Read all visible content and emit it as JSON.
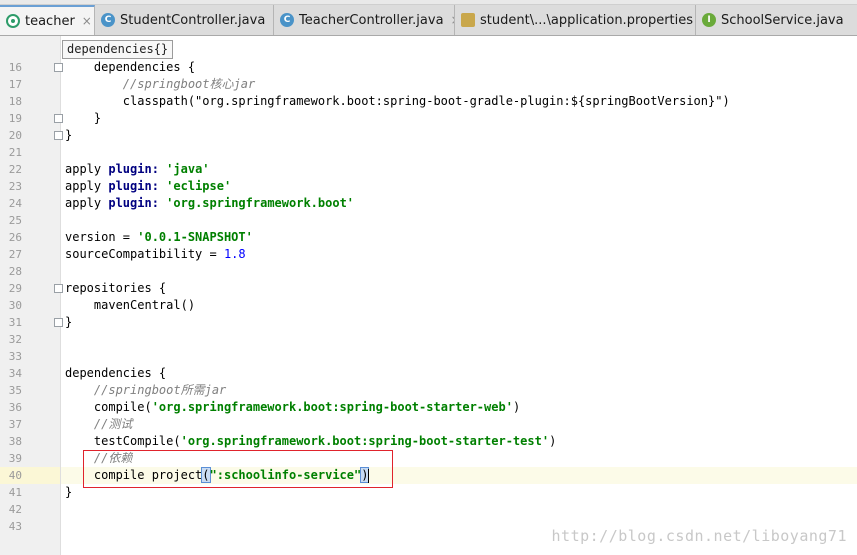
{
  "tabs": [
    {
      "label": "teacher",
      "icon": "gradle-icon",
      "active": true
    },
    {
      "label": "StudentController.java",
      "icon": "class-icon",
      "active": false
    },
    {
      "label": "TeacherController.java",
      "icon": "class-icon",
      "active": false
    },
    {
      "label": "student\\...\\application.properties",
      "icon": "properties-icon",
      "active": false
    },
    {
      "label": "SchoolService.java",
      "icon": "interface-icon",
      "active": false
    }
  ],
  "tab_close_glyph": "×",
  "tooltip": "dependencies{}",
  "icon_letters": {
    "class": "C",
    "interface": "I"
  },
  "lines": [
    {
      "num": "16",
      "segs": [
        {
          "t": "    dependencies {",
          "c": ""
        }
      ]
    },
    {
      "num": "17",
      "segs": [
        {
          "t": "        //springboot核心jar",
          "c": "cmt"
        }
      ]
    },
    {
      "num": "18",
      "segs": [
        {
          "t": "        classpath(\"org.springframework.boot:spring-boot-gradle-plugin:${springBootVersion}\")",
          "c": ""
        }
      ]
    },
    {
      "num": "19",
      "segs": [
        {
          "t": "    }",
          "c": ""
        }
      ]
    },
    {
      "num": "20",
      "segs": [
        {
          "t": "}",
          "c": ""
        }
      ]
    },
    {
      "num": "21",
      "segs": []
    },
    {
      "num": "22",
      "segs": [
        {
          "t": "apply ",
          "c": ""
        },
        {
          "t": "plugin:",
          "c": "kw"
        },
        {
          "t": " ",
          "c": ""
        },
        {
          "t": "'java'",
          "c": "str"
        }
      ]
    },
    {
      "num": "23",
      "segs": [
        {
          "t": "apply ",
          "c": ""
        },
        {
          "t": "plugin:",
          "c": "kw"
        },
        {
          "t": " ",
          "c": ""
        },
        {
          "t": "'eclipse'",
          "c": "str"
        }
      ]
    },
    {
      "num": "24",
      "segs": [
        {
          "t": "apply ",
          "c": ""
        },
        {
          "t": "plugin:",
          "c": "kw"
        },
        {
          "t": " ",
          "c": ""
        },
        {
          "t": "'org.springframework.boot'",
          "c": "str"
        }
      ]
    },
    {
      "num": "25",
      "segs": []
    },
    {
      "num": "26",
      "segs": [
        {
          "t": "version = ",
          "c": ""
        },
        {
          "t": "'0.0.1-SNAPSHOT'",
          "c": "str"
        }
      ]
    },
    {
      "num": "27",
      "segs": [
        {
          "t": "sourceCompatibility = ",
          "c": ""
        },
        {
          "t": "1.8",
          "c": "num"
        }
      ]
    },
    {
      "num": "28",
      "segs": []
    },
    {
      "num": "29",
      "segs": [
        {
          "t": "repositories {",
          "c": ""
        }
      ]
    },
    {
      "num": "30",
      "segs": [
        {
          "t": "    mavenCentral()",
          "c": ""
        }
      ]
    },
    {
      "num": "31",
      "segs": [
        {
          "t": "}",
          "c": ""
        }
      ]
    },
    {
      "num": "32",
      "segs": []
    },
    {
      "num": "33",
      "segs": []
    },
    {
      "num": "34",
      "segs": [
        {
          "t": "dependencies {",
          "c": ""
        }
      ]
    },
    {
      "num": "35",
      "segs": [
        {
          "t": "    //springboot所需jar",
          "c": "cmt"
        }
      ]
    },
    {
      "num": "36",
      "segs": [
        {
          "t": "    compile(",
          "c": ""
        },
        {
          "t": "'org.springframework.boot:spring-boot-starter-web'",
          "c": "str"
        },
        {
          "t": ")",
          "c": ""
        }
      ]
    },
    {
      "num": "37",
      "segs": [
        {
          "t": "    //测试",
          "c": "cmt"
        }
      ]
    },
    {
      "num": "38",
      "segs": [
        {
          "t": "    testCompile(",
          "c": ""
        },
        {
          "t": "'org.springframework.boot:spring-boot-starter-test'",
          "c": "str"
        },
        {
          "t": ")",
          "c": ""
        }
      ]
    },
    {
      "num": "39",
      "segs": [
        {
          "t": "    //依赖",
          "c": "cmt"
        }
      ]
    },
    {
      "num": "40",
      "segs": [
        {
          "t": "    compile project",
          "c": ""
        },
        {
          "t": "(",
          "c": "hl"
        },
        {
          "t": "\":schoolinfo-service\"",
          "c": "str"
        },
        {
          "t": ")",
          "c": "hl"
        }
      ]
    },
    {
      "num": "41",
      "segs": [
        {
          "t": "}",
          "c": ""
        }
      ]
    },
    {
      "num": "42",
      "segs": []
    },
    {
      "num": "43",
      "segs": []
    }
  ],
  "watermark": "http://blog.csdn.net/liboyang71"
}
